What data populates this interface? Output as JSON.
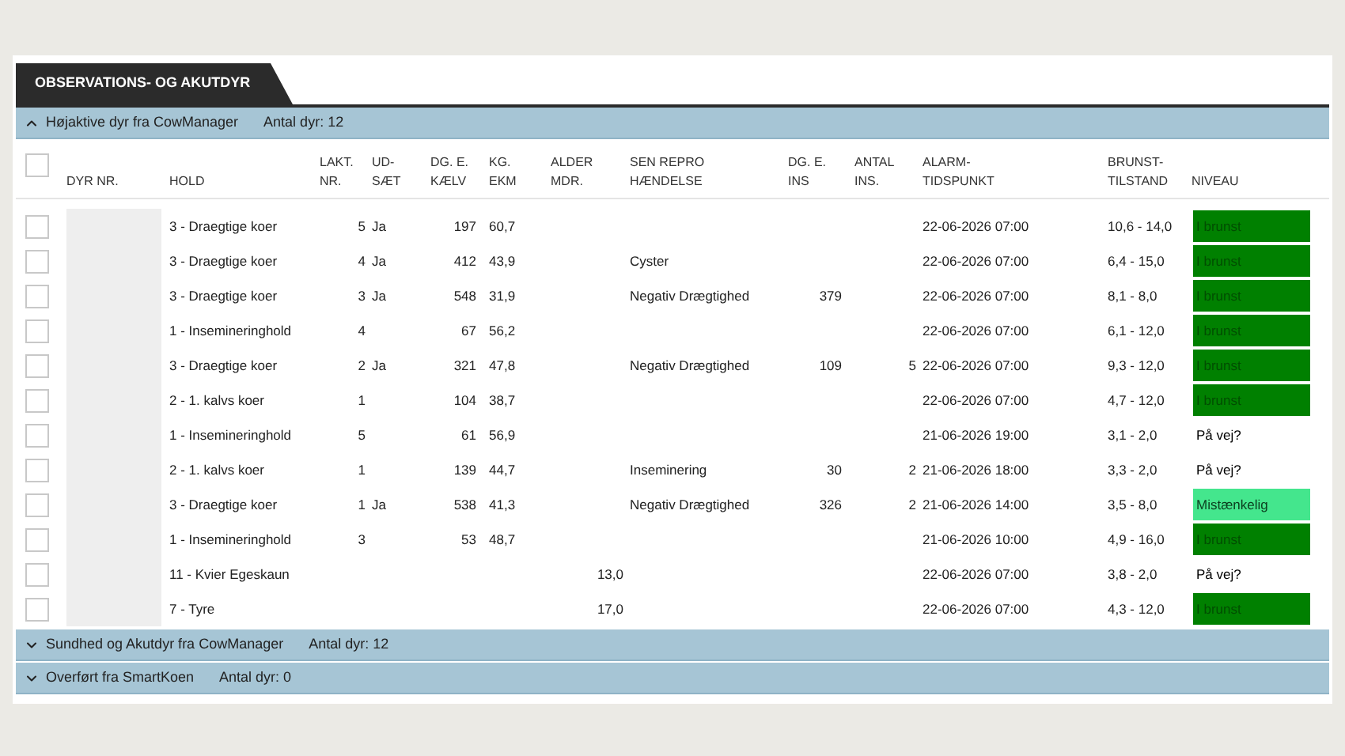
{
  "tab": {
    "label": "OBSERVATIONS- OG AKUTDYR",
    "selected": true
  },
  "columns": [
    {
      "label": [
        "DYR NR."
      ]
    },
    {
      "label": [
        "HOLD"
      ]
    },
    {
      "label": [
        "LAKT.",
        "NR."
      ]
    },
    {
      "label": [
        "UD-",
        "SÆT"
      ]
    },
    {
      "label": [
        "DG. E.",
        "KÆLV"
      ]
    },
    {
      "label": [
        "KG.",
        "EKM"
      ]
    },
    {
      "label": [
        "ALDER",
        "MDR."
      ]
    },
    {
      "label": [
        "SEN REPRO",
        "HÆNDELSE"
      ]
    },
    {
      "label": [
        "DG. E.",
        "INS"
      ]
    },
    {
      "label": [
        "ANTAL",
        "INS."
      ]
    },
    {
      "label": [
        "ALARM-",
        "TIDSPUNKT"
      ]
    },
    {
      "label": [
        "BRUNST-",
        "TILSTAND"
      ]
    },
    {
      "label": [
        "NIVEAU"
      ]
    }
  ],
  "sections": [
    {
      "title": "Højaktive dyr fra CowManager",
      "count": "Antal dyr: 12",
      "expanded": true,
      "header_checked": false,
      "rows": [
        {
          "checked": false,
          "hold": "3 - Draegtige koer",
          "lakt": "5",
          "udsaet": "Ja",
          "dg_kaelv": "197",
          "kg_ekm": "60,7",
          "alarm": "22-06-2026 07:00",
          "brunst": "10,6 - 14,0",
          "niveau": "I brunst",
          "color": "#008000"
        },
        {
          "checked": false,
          "hold": "3 - Draegtige koer",
          "lakt": "4",
          "udsaet": "Ja",
          "dg_kaelv": "412",
          "kg_ekm": "43,9",
          "repro": "Cyster",
          "alarm": "22-06-2026 07:00",
          "brunst": "6,4 - 15,0",
          "niveau": "I brunst",
          "color": "#008000"
        },
        {
          "checked": false,
          "hold": "3 - Draegtige koer",
          "lakt": "3",
          "udsaet": "Ja",
          "dg_kaelv": "548",
          "kg_ekm": "31,9",
          "repro": "Negativ Drægtighed",
          "dg_ins": "379",
          "alarm": "22-06-2026 07:00",
          "brunst": "8,1 - 8,0",
          "niveau": "I brunst",
          "color": "#008000"
        },
        {
          "checked": false,
          "hold": "1 - Insemineringhold",
          "lakt": "4",
          "dg_kaelv": "67",
          "kg_ekm": "56,2",
          "alarm": "22-06-2026 07:00",
          "brunst": "6,1 - 12,0",
          "niveau": "I brunst",
          "color": "#008000"
        },
        {
          "checked": false,
          "hold": "3 - Draegtige koer",
          "lakt": "2",
          "udsaet": "Ja",
          "dg_kaelv": "321",
          "kg_ekm": "47,8",
          "repro": "Negativ Drægtighed",
          "dg_ins": "109",
          "antal_ins": "5",
          "alarm": "22-06-2026 07:00",
          "brunst": "9,3 - 12,0",
          "niveau": "I brunst",
          "color": "#008000"
        },
        {
          "checked": false,
          "hold": "2 - 1. kalvs koer",
          "lakt": "1",
          "dg_kaelv": "104",
          "kg_ekm": "38,7",
          "alarm": "22-06-2026 07:00",
          "brunst": "4,7 - 12,0",
          "niveau": "I brunst",
          "color": "#008000"
        },
        {
          "checked": false,
          "hold": "1 - Insemineringhold",
          "lakt": "5",
          "dg_kaelv": "61",
          "kg_ekm": "56,9",
          "alarm": "21-06-2026 19:00",
          "brunst": "3,1 - 2,0",
          "niveau": "På vej?"
        },
        {
          "checked": false,
          "hold": "2 - 1. kalvs koer",
          "lakt": "1",
          "dg_kaelv": "139",
          "kg_ekm": "44,7",
          "repro": "Inseminering",
          "dg_ins": "30",
          "antal_ins": "2",
          "alarm": "21-06-2026 18:00",
          "brunst": "3,3 - 2,0",
          "niveau": "På vej?"
        },
        {
          "checked": false,
          "hold": "3 - Draegtige koer",
          "lakt": "1",
          "udsaet": "Ja",
          "dg_kaelv": "538",
          "kg_ekm": "41,3",
          "repro": "Negativ Drægtighed",
          "dg_ins": "326",
          "antal_ins": "2",
          "alarm": "21-06-2026 14:00",
          "brunst": "3,5 - 8,0",
          "niveau": "Mistænkelig",
          "color": "#44e68d"
        },
        {
          "checked": false,
          "hold": "1 - Insemineringhold",
          "lakt": "3",
          "dg_kaelv": "53",
          "kg_ekm": "48,7",
          "alarm": "21-06-2026 10:00",
          "brunst": "4,9 - 16,0",
          "niveau": "I brunst",
          "color": "#008000"
        },
        {
          "checked": false,
          "hold": "11 - Kvier Egeskaun",
          "alder": "13,0",
          "alarm": "22-06-2026 07:00",
          "brunst": "3,8 - 2,0",
          "niveau": "På vej?"
        },
        {
          "checked": false,
          "hold": "7 - Tyre",
          "alder": "17,0",
          "alarm": "22-06-2026 07:00",
          "brunst": "4,3 - 12,0",
          "niveau": "I brunst",
          "color": "#008000"
        }
      ]
    },
    {
      "title": "Sundhed og Akutdyr fra CowManager",
      "count": "Antal dyr: 12",
      "expanded": false
    },
    {
      "title": "Overført fra SmartKoen",
      "count": "Antal dyr: 0",
      "expanded": false
    }
  ]
}
